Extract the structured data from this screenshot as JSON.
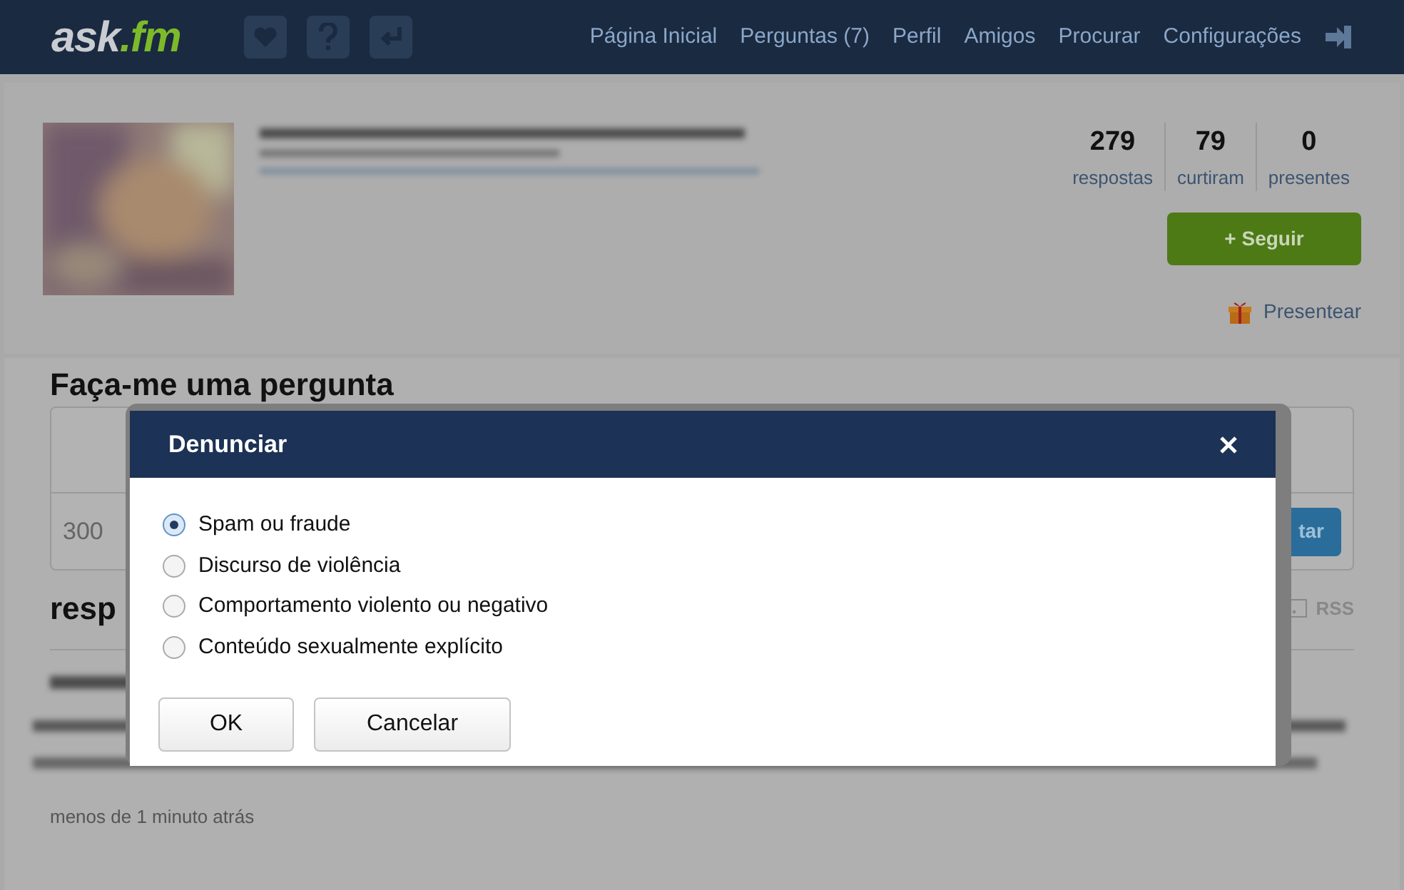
{
  "header": {
    "logo_main": "ask",
    "logo_accent": ".fm",
    "nav": [
      "Página Inicial",
      "Perguntas (7)",
      "Perfil",
      "Amigos",
      "Procurar",
      "Configurações"
    ]
  },
  "profile": {
    "stats": [
      {
        "value": "279",
        "label": "respostas"
      },
      {
        "value": "79",
        "label": "curtiram"
      },
      {
        "value": "0",
        "label": "presentes"
      }
    ],
    "follow_button": "+ Seguir",
    "gift_link": "Presentear"
  },
  "ask_section": {
    "title": "Faça-me uma pergunta",
    "counter": "300",
    "submit_button": "tar"
  },
  "answers_section": {
    "title": "resp",
    "rss": "RSS",
    "time": "menos de 1 minuto atrás"
  },
  "dialog": {
    "title": "Denunciar",
    "options": [
      {
        "label": "Spam ou fraude",
        "selected": true
      },
      {
        "label": "Discurso de violência",
        "selected": false
      },
      {
        "label": "Comportamento violento ou negativo",
        "selected": false
      },
      {
        "label": "Conteúdo sexualmente explícito",
        "selected": false
      }
    ],
    "buttons": [
      "OK",
      "Cancelar"
    ]
  }
}
